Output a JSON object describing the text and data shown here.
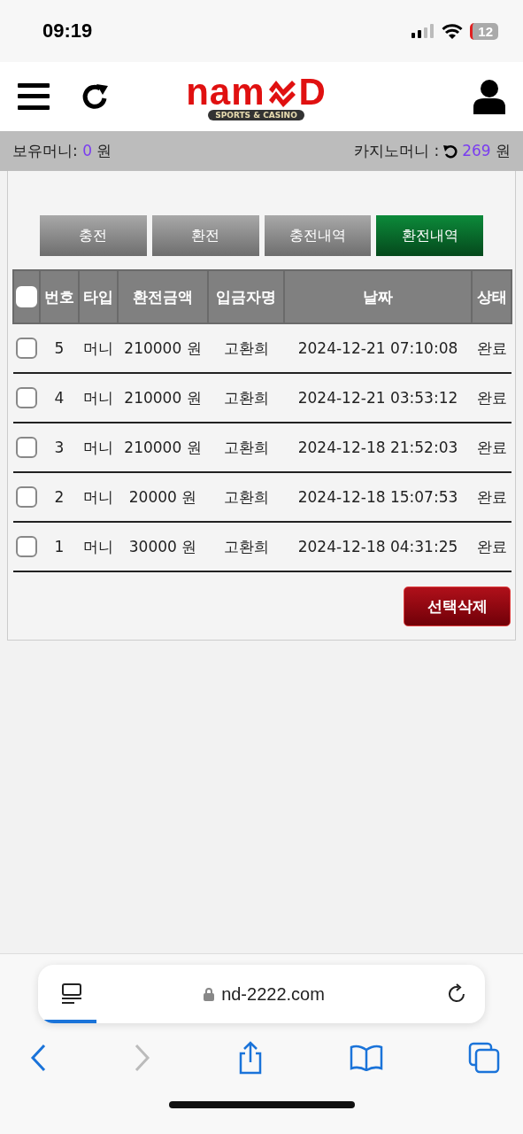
{
  "status_bar": {
    "time": "09:19",
    "battery": "12"
  },
  "header": {
    "logo": {
      "left": "nam",
      "right": "D",
      "tagline": "SPORTS & CASINO"
    }
  },
  "balance": {
    "own_label": "보유머니:",
    "own_value": "0",
    "own_unit": "원",
    "casino_label": "카지노머니 :",
    "casino_value": "269",
    "casino_unit": "원"
  },
  "tabs": [
    {
      "label": "충전",
      "selected": false
    },
    {
      "label": "환전",
      "selected": false
    },
    {
      "label": "충전내역",
      "selected": false
    },
    {
      "label": "환전내역",
      "selected": true
    }
  ],
  "table": {
    "select_all": {
      "checked": false
    },
    "columns": [
      "번호",
      "타입",
      "환전금액",
      "입금자명",
      "날짜",
      "상태"
    ],
    "rows": [
      {
        "checked": false,
        "cells": [
          "5",
          "머니",
          "210000 원",
          "고환희",
          "2024-12-21 07:10:08",
          "완료"
        ]
      },
      {
        "checked": false,
        "cells": [
          "4",
          "머니",
          "210000 원",
          "고환희",
          "2024-12-21 03:53:12",
          "완료"
        ]
      },
      {
        "checked": false,
        "cells": [
          "3",
          "머니",
          "210000 원",
          "고환희",
          "2024-12-18 21:52:03",
          "완료"
        ]
      },
      {
        "checked": false,
        "cells": [
          "2",
          "머니",
          "20000 원",
          "고환희",
          "2024-12-18 15:07:53",
          "완료"
        ]
      },
      {
        "checked": false,
        "cells": [
          "1",
          "머니",
          "30000 원",
          "고환희",
          "2024-12-18 04:31:25",
          "완료"
        ]
      }
    ]
  },
  "delete_button": "선택삭제",
  "browser": {
    "url": "nd-2222.com"
  }
}
